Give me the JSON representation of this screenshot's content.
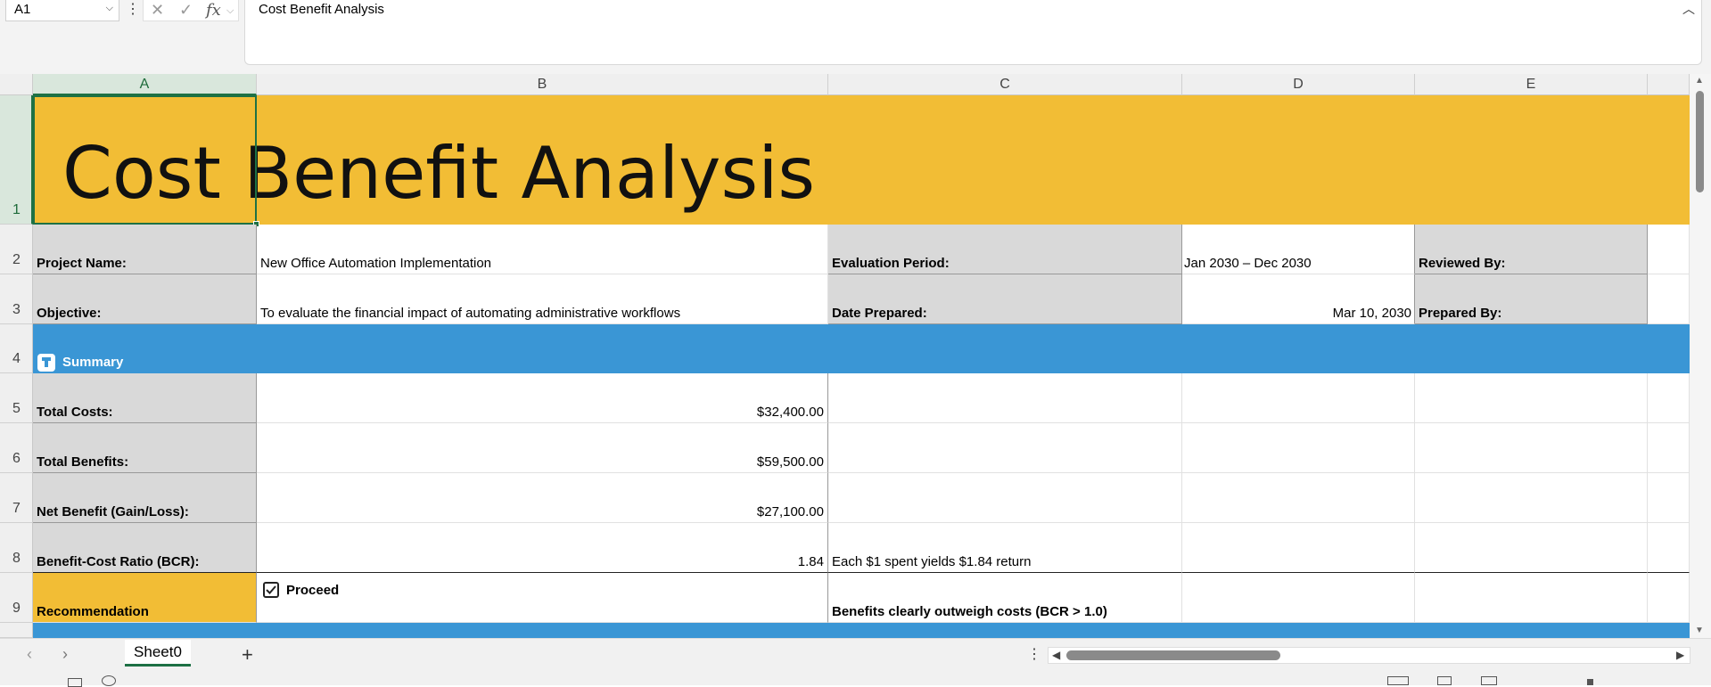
{
  "formula_bar": {
    "name_box": "A1",
    "fx": "fx",
    "cancel_icon": "✕",
    "confirm_icon": "✓",
    "formula": "Cost Benefit Analysis"
  },
  "columns": [
    "A",
    "B",
    "C",
    "D",
    "E"
  ],
  "rows": [
    "1",
    "2",
    "3",
    "4",
    "5",
    "6",
    "7",
    "8",
    "9"
  ],
  "title": "Cost Benefit Analysis",
  "header_info": {
    "project_name_label": "Project Name:",
    "project_name": "New Office Automation Implementation",
    "evaluation_period_label": "Evaluation Period:",
    "evaluation_period": "Jan 2030 – Dec 2030",
    "reviewed_by_label": "Reviewed By:",
    "objective_label": "Objective:",
    "objective": "To evaluate the financial impact of automating administrative workflows",
    "date_prepared_label": "Date Prepared:",
    "date_prepared": "Mar 10, 2030",
    "prepared_by_label": "Prepared By:"
  },
  "summary": {
    "label": "Summary",
    "total_costs_label": "Total Costs:",
    "total_costs": "$32,400.00",
    "total_benefits_label": "Total Benefits:",
    "total_benefits": "$59,500.00",
    "net_benefit_label": "Net Benefit (Gain/Loss):",
    "net_benefit": "$27,100.00",
    "bcr_label": "Benefit-Cost Ratio (BCR):",
    "bcr": "1.84",
    "bcr_note": "Each $1 spent yields $1.84 return",
    "recommendation_label": "Recommendation",
    "recommendation": "Proceed",
    "recommendation_note": "Benefits clearly outweigh costs (BCR > 1.0)"
  },
  "sheet_tabs": [
    "Sheet0"
  ],
  "colors": {
    "title_band": "#f2bd35",
    "summary_band": "#3a96d5",
    "label_gray": "#d9d9d9",
    "selection": "#1e7145"
  }
}
